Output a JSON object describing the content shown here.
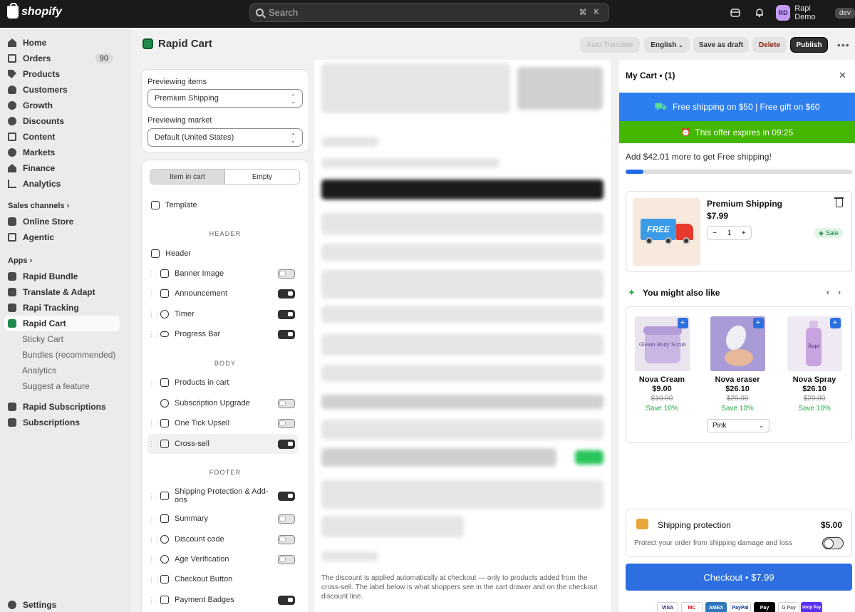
{
  "topbar": {
    "brand": "shopify",
    "search_placeholder": "Search",
    "shortcut_cmd": "⌘",
    "shortcut_key": "K",
    "user_initials": "RD",
    "user_name": "Rapi Demo",
    "env_badge": "dev"
  },
  "sidebar": {
    "main": [
      {
        "label": "Home",
        "icon": "home-icon"
      },
      {
        "label": "Orders",
        "icon": "orders-icon",
        "count": "90"
      },
      {
        "label": "Products",
        "icon": "tag-icon"
      },
      {
        "label": "Customers",
        "icon": "person-icon"
      },
      {
        "label": "Growth",
        "icon": "growth-icon"
      },
      {
        "label": "Discounts",
        "icon": "discount-icon"
      },
      {
        "label": "Content",
        "icon": "content-icon"
      },
      {
        "label": "Markets",
        "icon": "globe-icon"
      },
      {
        "label": "Finance",
        "icon": "bank-icon"
      },
      {
        "label": "Analytics",
        "icon": "chart-icon"
      }
    ],
    "sales_channels_title": "Sales channels",
    "sales_channels": [
      {
        "label": "Online Store",
        "icon": "store-icon"
      },
      {
        "label": "Agentic",
        "icon": "agentic-icon"
      }
    ],
    "apps_title": "Apps",
    "apps": [
      {
        "label": "Rapid Bundle",
        "icon": "app-icon"
      },
      {
        "label": "Translate & Adapt",
        "icon": "app-icon"
      },
      {
        "label": "Rapi Tracking",
        "icon": "app-icon"
      },
      {
        "label": "Rapid Cart",
        "icon": "app-icon"
      }
    ],
    "rapid_cart_sub": [
      "Sticky Cart",
      "Bundles (recommended)",
      "Analytics",
      "Suggest a feature"
    ],
    "apps_more": [
      {
        "label": "Rapid Subscriptions",
        "icon": "app-icon"
      },
      {
        "label": "Subscriptions",
        "icon": "app-icon"
      }
    ],
    "settings": "Settings"
  },
  "header": {
    "title": "Rapid Cart",
    "auto_translate": "Auto Translate",
    "language": "English",
    "save_draft": "Save as draft",
    "delete": "Delete",
    "publish": "Publish"
  },
  "preview": {
    "items_label": "Previewing items",
    "items_value": "Premium Shipping",
    "market_label": "Previewing market",
    "market_value": "Default (United States)"
  },
  "editor": {
    "seg_in_cart": "Item in cart",
    "seg_empty": "Empty",
    "template": "Template",
    "header_title": "HEADER",
    "header_row": "Header",
    "header_items": [
      {
        "label": "Banner Image",
        "on": false
      },
      {
        "label": "Announcement",
        "on": true
      },
      {
        "label": "Timer",
        "on": true
      },
      {
        "label": "Progress Bar",
        "on": true
      }
    ],
    "body_title": "BODY",
    "body_items": [
      {
        "label": "Products in cart"
      },
      {
        "label": "Subscription Upgrade",
        "on": false
      },
      {
        "label": "One Tick Upsell",
        "on": false
      },
      {
        "label": "Cross-sell",
        "on": true
      }
    ],
    "footer_title": "FOOTER",
    "footer_items": [
      {
        "label": "Shipping Protection & Add-ons",
        "on": true
      },
      {
        "label": "Summary",
        "on": false
      },
      {
        "label": "Discount code",
        "on": false
      },
      {
        "label": "Age Verification",
        "on": false
      },
      {
        "label": "Checkout Button"
      },
      {
        "label": "Payment Badges",
        "on": true
      }
    ]
  },
  "middle": {
    "note": "The discount is applied automatically at checkout — only to products added from the cross-sell. The label below is what shoppers see in the cart drawer and on the checkout discount line."
  },
  "cart": {
    "title": "My Cart • (1)",
    "shipping_banner": "Free shipping on $50 | Free gift on $60",
    "timer_banner": "This offer expires in 09:25",
    "shipping_msg": "Add $42.01 more to get Free shipping!",
    "progress": 0.08,
    "item": {
      "name": "Premium Shipping",
      "price": "$7.99",
      "qty": "1",
      "minus": "−",
      "plus": "+",
      "sale": "Sale",
      "image_text": "FREE"
    },
    "upsell_title": "You might also like",
    "upsell_products": [
      {
        "name": "Nova Cream",
        "price": "$9.00",
        "old": "$10.00",
        "save": "Save 10%",
        "color": "#c9b6e4",
        "label": "Gleam Body Scrub"
      },
      {
        "name": "Nova eraser",
        "price": "$26.10",
        "old": "$29.00",
        "save": "Save 10%",
        "color": "#a99bd6",
        "label": ""
      },
      {
        "name": "Nova Spray",
        "price": "$26.10",
        "old": "$29.00",
        "save": "Save 10%",
        "color": "#efe9f3",
        "label": "Rapi"
      }
    ],
    "variant": "Pink",
    "protection": {
      "title": "Shipping protection",
      "price": "$5.00",
      "desc": "Protect your order from shipping damage and loss"
    },
    "checkout": "Checkout • $7.99",
    "payments": [
      "VISA",
      "MC",
      "AMEX",
      "PayPal",
      "Pay",
      "G Pay",
      "shop Pay"
    ],
    "colors": {
      "banner_blue": "#2d7ff0",
      "timer_green": "#44b700",
      "checkout_blue": "#2d6fe0"
    }
  }
}
